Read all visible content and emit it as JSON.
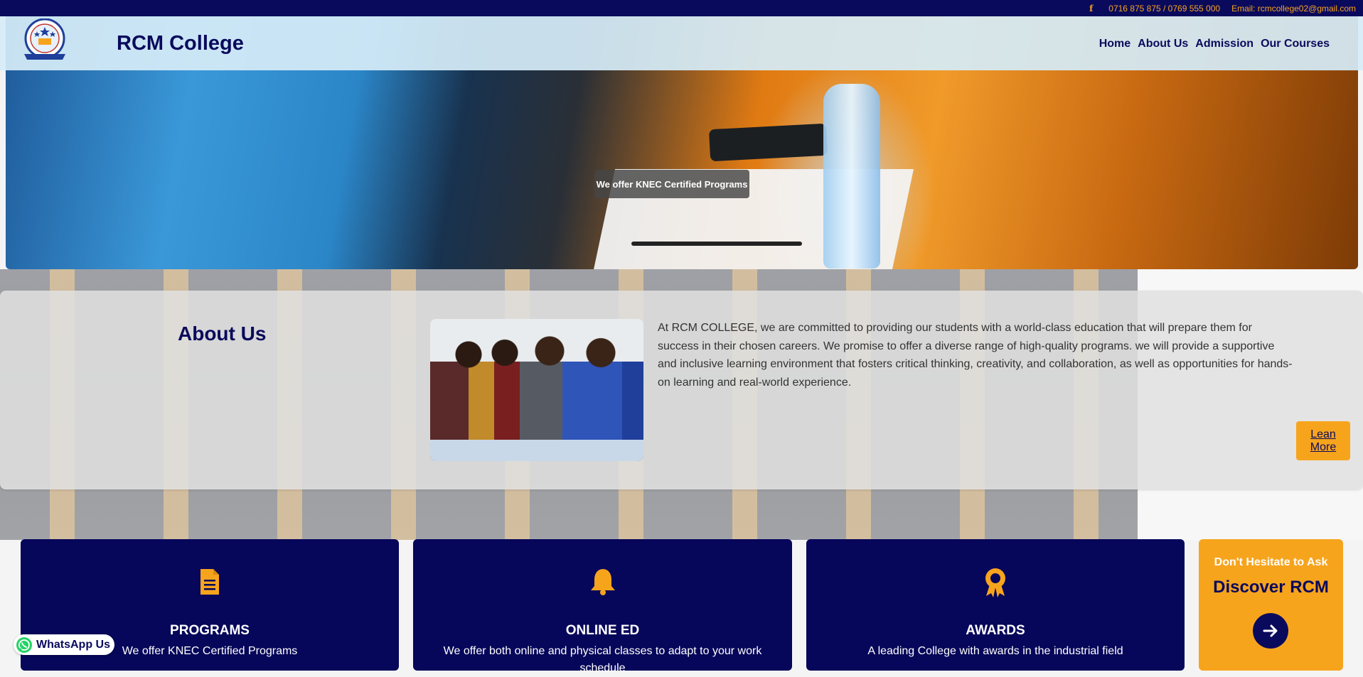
{
  "topbar": {
    "facebook_icon": "f",
    "phone": "0716 875 875 / 0769 555 000",
    "email": "Email: rcmcollege02@gmail.com"
  },
  "header": {
    "brand": "RCM College",
    "nav": [
      "Home",
      "About Us",
      "Admission",
      "Our Courses"
    ]
  },
  "hero": {
    "badge": "We offer KNEC Certified Programs"
  },
  "about": {
    "title": "About Us",
    "text": "At RCM COLLEGE, we are committed to providing our students with a world-class education that will prepare them for success in their chosen careers. We promise to offer a diverse range of high-quality programs. we will provide a supportive and inclusive learning environment that fosters critical thinking, creativity, and collaboration, as well as opportunities for hands-on learning and real-world experience.",
    "button_line1": "Lean",
    "button_line2": "More"
  },
  "cards": [
    {
      "icon": "document-icon",
      "title": "PROGRAMS",
      "desc": "We offer KNEC Certified Programs"
    },
    {
      "icon": "bell-icon",
      "title": "ONLINE ED",
      "desc": "We offer both online and physical classes to adapt to your work schedule"
    },
    {
      "icon": "award-icon",
      "title": "AWARDS",
      "desc": "A leading College with awards in the industrial field"
    }
  ],
  "cta": {
    "ask": "Don't Hesitate to Ask",
    "discover": "Discover RCM",
    "icon": "arrow-right-icon"
  },
  "whatsapp": {
    "label": "WhatsApp Us",
    "icon": "whatsapp-icon"
  },
  "colors": {
    "navy": "#0a0a5c",
    "orange": "#f7a41d"
  }
}
